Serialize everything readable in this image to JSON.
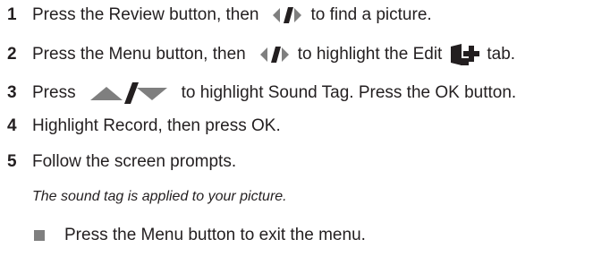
{
  "steps": [
    {
      "number": "1",
      "text_before": "Press the Review button, then",
      "text_after": "to find a picture."
    },
    {
      "number": "2",
      "text_before": "Press the Menu button, then",
      "text_middle": "to highlight the Edit",
      "text_after": "tab."
    },
    {
      "number": "3",
      "text_before": "Press",
      "text_after": "to highlight Sound Tag. Press the OK button."
    },
    {
      "number": "4",
      "text": "Highlight Record, then press OK."
    },
    {
      "number": "5",
      "text": "Follow the screen prompts."
    }
  ],
  "result_note": "The sound tag is applied to your picture.",
  "bullet": {
    "text": "Press the Menu button to exit the menu."
  },
  "icons": {
    "left_right": "left-right-arrows-icon",
    "up_down": "up-down-arrows-icon",
    "edit_tab": "edit-tab-icon"
  },
  "colors": {
    "text": "#231f20",
    "icon_gray": "#7f7f7f",
    "icon_black": "#231f20"
  }
}
